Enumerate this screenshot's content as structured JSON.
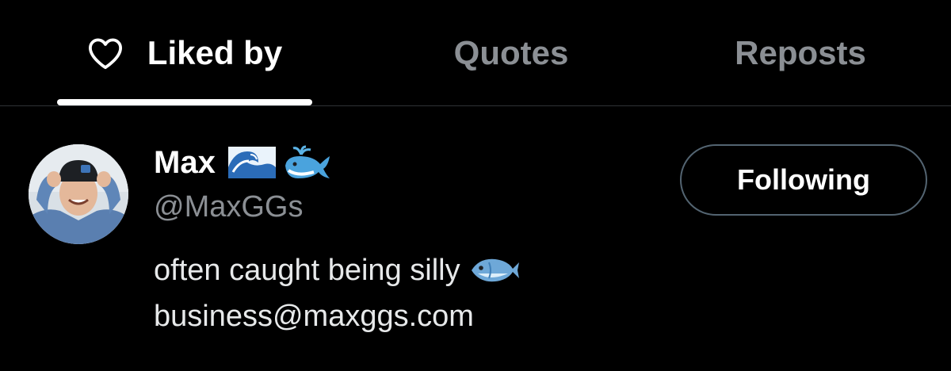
{
  "tabs": [
    {
      "label": "Liked by",
      "icon": "heart-icon",
      "active": true
    },
    {
      "label": "Quotes",
      "active": false
    },
    {
      "label": "Reposts",
      "active": false
    }
  ],
  "user": {
    "display_name": "Max",
    "name_emojis": [
      "water-wave-icon",
      "spouting-whale-icon"
    ],
    "handle": "@MaxGGs",
    "bio_line_1": "often caught being silly",
    "bio_line_1_emoji": "fish-icon",
    "bio_line_2": "business@maxggs.com",
    "follow_button_label": "Following"
  },
  "colors": {
    "background": "#000000",
    "active_text": "#ffffff",
    "inactive_text": "#8b8f94",
    "divider": "#2f3336",
    "button_border": "#536471"
  }
}
